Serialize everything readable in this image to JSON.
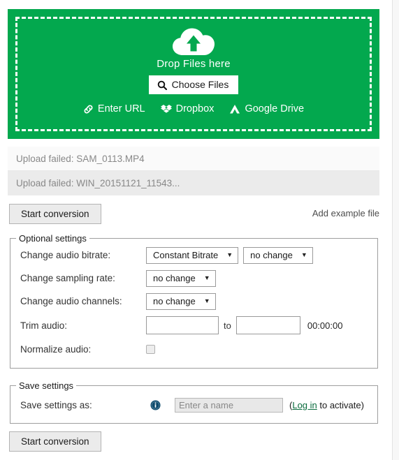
{
  "theme": {
    "brand_green": "#03A84E",
    "link_green": "#0a6b3d",
    "info_navy": "#0d4a6b",
    "row_light": "#fafafa",
    "row_dark": "#ebebeb"
  },
  "dropzone": {
    "icon": "cloud-upload-icon",
    "drop_label": "Drop Files here",
    "choose_files_label": "Choose Files",
    "choose_files_icon": "search-icon",
    "sources": [
      {
        "label": "Enter URL",
        "icon": "link-icon"
      },
      {
        "label": "Dropbox",
        "icon": "dropbox-icon"
      },
      {
        "label": "Google Drive",
        "icon": "google-drive-icon"
      }
    ]
  },
  "uploads": [
    {
      "message": "Upload failed: SAM_0113.MP4"
    },
    {
      "message": "Upload failed: WIN_20151121_11543..."
    }
  ],
  "actions": {
    "start_conversion_top": "Start conversion",
    "start_conversion_bottom": "Start conversion",
    "add_example_file": "Add example file"
  },
  "optional_settings": {
    "legend": "Optional settings",
    "rows": {
      "bitrate": {
        "label": "Change audio bitrate:",
        "mode_value": "Constant Bitrate",
        "value": "no change"
      },
      "sampling": {
        "label": "Change sampling rate:",
        "value": "no change"
      },
      "channels": {
        "label": "Change audio channels:",
        "value": "no change"
      },
      "trim": {
        "label": "Trim audio:",
        "start_value": "",
        "separator": "to",
        "end_value": "",
        "duration": "00:00:00"
      },
      "normalize": {
        "label": "Normalize audio:",
        "checked": false
      }
    }
  },
  "save_settings": {
    "legend": "Save settings",
    "label": "Save settings as:",
    "info_icon": "info-icon",
    "name_placeholder": "Enter a name",
    "name_value": "",
    "note_open": "(",
    "login_link": "Log in",
    "note_rest": " to activate)"
  }
}
